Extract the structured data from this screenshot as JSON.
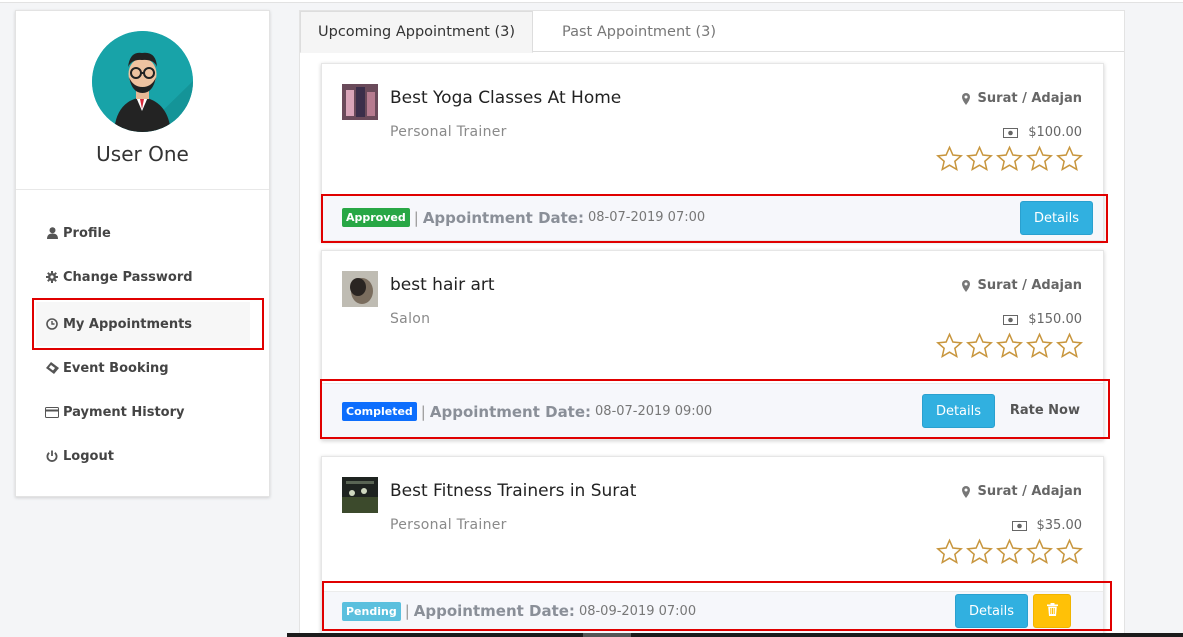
{
  "sidebar": {
    "user_name": "User One",
    "menu": [
      {
        "label": "Profile",
        "icon": "user-icon"
      },
      {
        "label": "Change Password",
        "icon": "gear-icon"
      },
      {
        "label": "My Appointments",
        "icon": "clock-icon"
      },
      {
        "label": "Event Booking",
        "icon": "ticket-icon"
      },
      {
        "label": "Payment History",
        "icon": "credit-card-icon"
      },
      {
        "label": "Logout",
        "icon": "power-icon"
      }
    ],
    "active_item": "My Appointments"
  },
  "tabs": [
    {
      "label": "Upcoming Appointment (3)",
      "active": true
    },
    {
      "label": "Past Appointment (3)",
      "active": false
    }
  ],
  "appointments": [
    {
      "title": "Best Yoga Classes At Home",
      "category": "Personal Trainer",
      "location": "Surat / Adajan",
      "price": "$100.00",
      "rating": 0,
      "status": "Approved",
      "date_label": "Appointment Date:",
      "date": "08-07-2019 07:00",
      "details_label": "Details"
    },
    {
      "title": "best hair art",
      "category": "Salon",
      "location": "Surat / Adajan",
      "price": "$150.00",
      "rating": 0,
      "status": "Completed",
      "date_label": "Appointment Date:",
      "date": "08-07-2019 09:00",
      "details_label": "Details",
      "rate_label": "Rate Now"
    },
    {
      "title": "Best Fitness Trainers in Surat",
      "category": "Personal Trainer",
      "location": "Surat / Adajan",
      "price": "$35.00",
      "rating": 0,
      "status": "Pending",
      "date_label": "Appointment Date:",
      "date": "08-09-2019 07:00",
      "details_label": "Details",
      "delete_icon": "trash-icon"
    }
  ],
  "colors": {
    "accent": "#31b0e0",
    "approved": "#28a745",
    "completed": "#0d6efd",
    "pending": "#5bc0de",
    "warning": "#ffc107",
    "highlight_frame": "#e00000",
    "star": "#c8963e"
  }
}
